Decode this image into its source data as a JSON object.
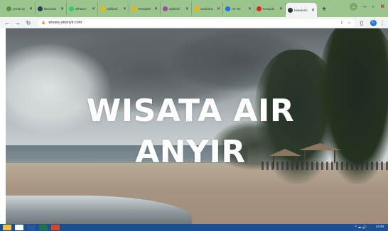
{
  "browser": {
    "tabs": [
      {
        "label": "portal.sy",
        "color": "#5a8f4a"
      },
      {
        "label": "Beranda",
        "color": "#2f3b4a"
      },
      {
        "label": "WhatsA",
        "color": "#25d366"
      },
      {
        "label": "Aplikasi",
        "color": "#f5b400"
      },
      {
        "label": "Template",
        "color": "#f5b400"
      },
      {
        "label": "aplikasi",
        "color": "#a04aa0"
      },
      {
        "label": "Soal Bus",
        "color": "#f5b400"
      },
      {
        "label": "Air Ter",
        "color": "#1a73e8"
      },
      {
        "label": "Kompilo",
        "color": "#e62117"
      },
      {
        "label": "Kawasan",
        "color": "#333333",
        "active": true
      }
    ],
    "tab_close": "✕",
    "new_tab": "+",
    "address": "wisata-airanyir.com",
    "profile_initial": "G"
  },
  "page": {
    "hero_title": "WISATA AIR ANYIR"
  },
  "taskbar": {
    "clock": "12:40",
    "items": [
      {
        "icon": "file-explorer-icon",
        "color": "#f0c040"
      },
      {
        "icon": "chrome-icon",
        "color": "#ffffff"
      },
      {
        "icon": "word-icon",
        "color": "#2b579a"
      },
      {
        "icon": "excel-icon",
        "color": "#217346"
      },
      {
        "icon": "powerpoint-icon",
        "color": "#d24726"
      }
    ]
  }
}
